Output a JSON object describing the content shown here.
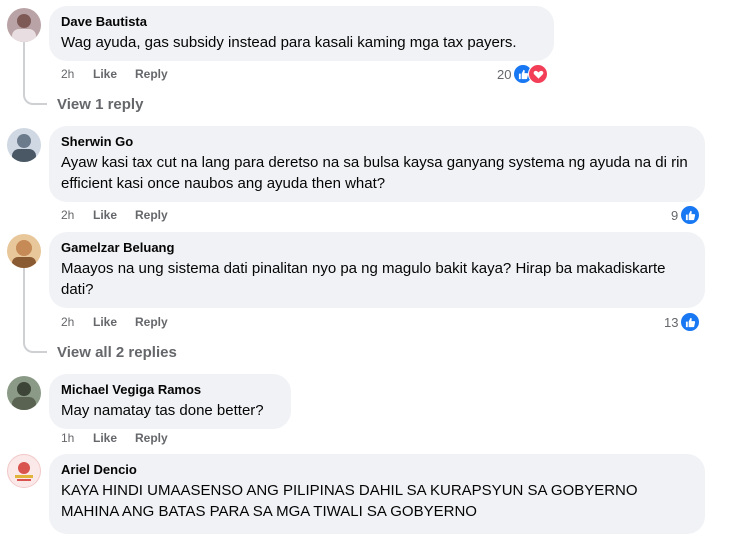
{
  "comments": [
    {
      "author": "Dave Bautista",
      "text": "Wag ayuda, gas subsidy instead para kasali kaming mga tax payers.",
      "time": "2h",
      "like": "Like",
      "reply": "Reply",
      "react_count": "20",
      "reactions": [
        "like-icon",
        "love-icon"
      ],
      "view_replies": "View 1 reply"
    },
    {
      "author": "Sherwin Go",
      "text": "Ayaw kasi tax cut na lang para deretso na sa bulsa kaysa ganyang systema ng ayuda na di rin efficient kasi once naubos ang ayuda then what?",
      "time": "2h",
      "like": "Like",
      "reply": "Reply",
      "react_count": "9",
      "reactions": [
        "like-icon"
      ]
    },
    {
      "author": "Gamelzar Beluang",
      "text": "Maayos na ung sistema dati pinalitan nyo pa ng magulo bakit kaya? Hirap ba makadiskarte dati?",
      "time": "2h",
      "like": "Like",
      "reply": "Reply",
      "react_count": "13",
      "reactions": [
        "like-icon"
      ],
      "view_replies": "View all 2 replies"
    },
    {
      "author": "Michael Vegiga Ramos",
      "text": "May namatay tas done better?",
      "time": "1h",
      "like": "Like",
      "reply": "Reply"
    },
    {
      "author": "Ariel Dencio",
      "text": "KAYA HINDI UMAASENSO ANG PILIPINAS DAHIL SA KURAPSYUN SA GOBYERNO MAHINA ANG BATAS PARA SA MGA TIWALI SA GOBYERNO"
    }
  ],
  "colors": {
    "bubble": "#f0f2f5",
    "meta": "#65676b",
    "like_blue": "#1877f2",
    "love_red": "#f33e58"
  }
}
